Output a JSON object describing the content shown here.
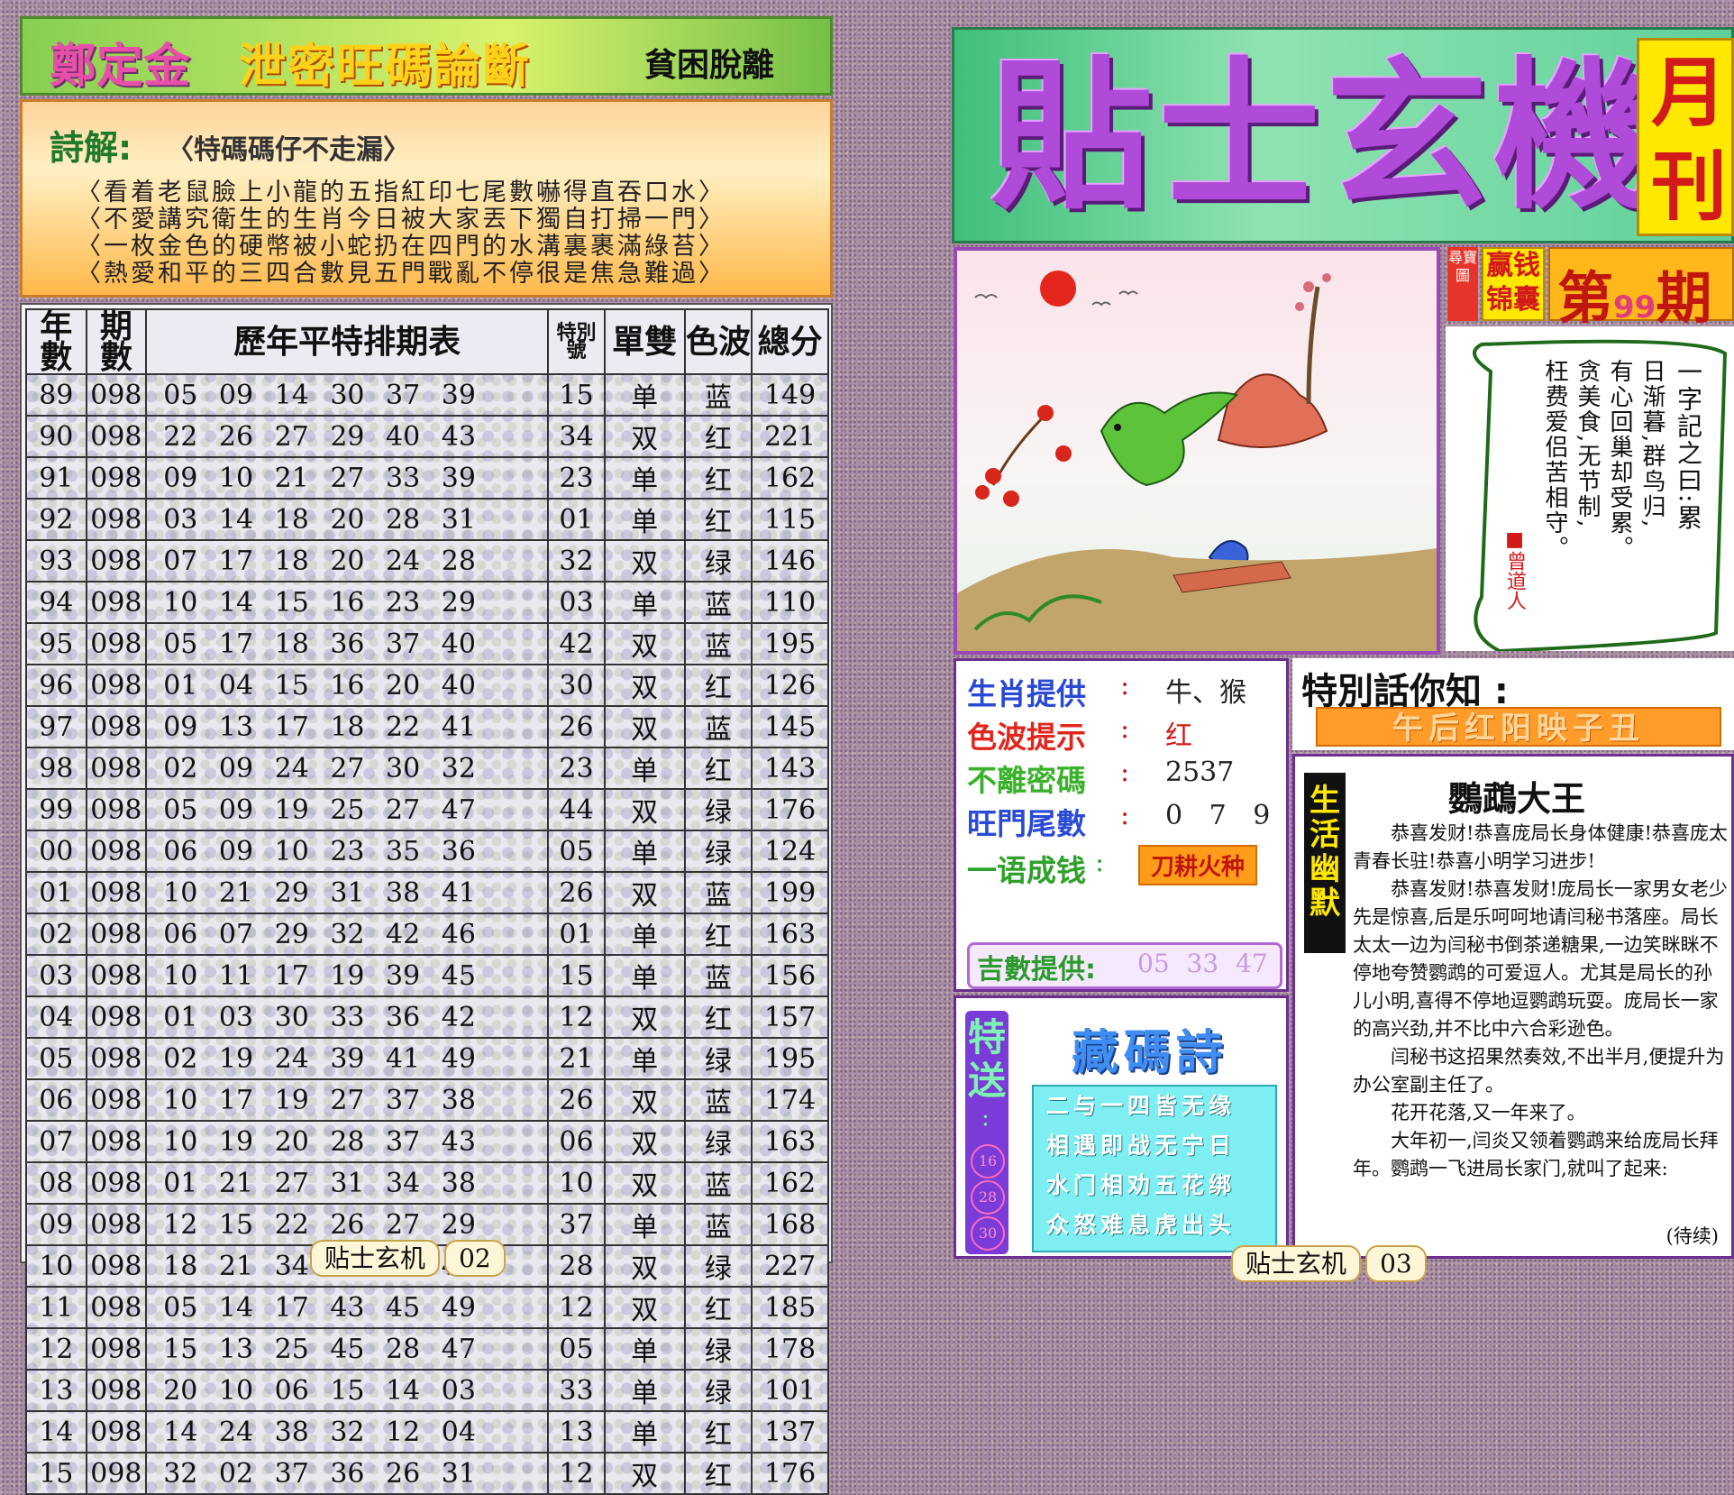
{
  "left": {
    "header": {
      "name": "鄭定金",
      "title": "泄密旺碼論斷",
      "subtitle": "貧困脫離"
    },
    "poem": {
      "label": "詩解:",
      "title": "〈特碼碼仔不走漏〉",
      "lines": [
        "〈看着老鼠臉上小龍的五指紅印七尾數嚇得直吞口水〉",
        "〈不愛講究衛生的生肖今日被大家丟下獨自打掃一門〉",
        "〈一枚金色的硬幣被小蛇扔在四門的水溝裏裹滿綠苔〉",
        "〈熱愛和平的三四合數見五門戰亂不停很是焦急難過〉"
      ]
    },
    "table": {
      "headers": [
        "年數",
        "期數",
        "歷年平特排期表",
        "特別號",
        "單雙",
        "色波",
        "總分"
      ],
      "rows": [
        [
          "89",
          "098",
          "05 09 14 30 37 39",
          "15",
          "单",
          "蓝",
          "149"
        ],
        [
          "90",
          "098",
          "22 26 27 29 40 43",
          "34",
          "双",
          "红",
          "221"
        ],
        [
          "91",
          "098",
          "09 10 21 27 33 39",
          "23",
          "单",
          "红",
          "162"
        ],
        [
          "92",
          "098",
          "03 14 18 20 28 31",
          "01",
          "单",
          "红",
          "115"
        ],
        [
          "93",
          "098",
          "07 17 18 20 24 28",
          "32",
          "双",
          "绿",
          "146"
        ],
        [
          "94",
          "098",
          "10 14 15 16 23 29",
          "03",
          "单",
          "蓝",
          "110"
        ],
        [
          "95",
          "098",
          "05 17 18 36 37 40",
          "42",
          "双",
          "蓝",
          "195"
        ],
        [
          "96",
          "098",
          "01 04 15 16 20 40",
          "30",
          "双",
          "红",
          "126"
        ],
        [
          "97",
          "098",
          "09 13 17 18 22 41",
          "26",
          "双",
          "蓝",
          "145"
        ],
        [
          "98",
          "098",
          "02 09 24 27 30 32",
          "23",
          "单",
          "红",
          "143"
        ],
        [
          "99",
          "098",
          "05 09 19 25 27 47",
          "44",
          "双",
          "绿",
          "176"
        ],
        [
          "00",
          "098",
          "06 09 10 23 35 36",
          "05",
          "单",
          "绿",
          "124"
        ],
        [
          "01",
          "098",
          "10 21 29 31 38 41",
          "26",
          "双",
          "蓝",
          "199"
        ],
        [
          "02",
          "098",
          "06 07 29 32 42 46",
          "01",
          "单",
          "红",
          "163"
        ],
        [
          "03",
          "098",
          "10 11 17 19 39 45",
          "15",
          "单",
          "蓝",
          "156"
        ],
        [
          "04",
          "098",
          "01 03 30 33 36 42",
          "12",
          "双",
          "红",
          "157"
        ],
        [
          "05",
          "098",
          "02 19 24 39 41 49",
          "21",
          "单",
          "绿",
          "195"
        ],
        [
          "06",
          "098",
          "10 17 19 27 37 38",
          "26",
          "双",
          "蓝",
          "174"
        ],
        [
          "07",
          "098",
          "10 19 20 28 37 43",
          "06",
          "双",
          "绿",
          "163"
        ],
        [
          "08",
          "098",
          "01 21 27 31 34 38",
          "10",
          "双",
          "蓝",
          "162"
        ],
        [
          "09",
          "098",
          "12 15 22 26 27 29",
          "37",
          "单",
          "蓝",
          "168"
        ],
        [
          "10",
          "098",
          "18 21 34 37 40 49",
          "28",
          "双",
          "绿",
          "227"
        ],
        [
          "11",
          "098",
          "05 14 17 43 45 49",
          "12",
          "双",
          "红",
          "185"
        ],
        [
          "12",
          "098",
          "15 13 25 45 28 47",
          "05",
          "单",
          "绿",
          "178"
        ],
        [
          "13",
          "098",
          "20 10 06 15 14 03",
          "33",
          "单",
          "绿",
          "101"
        ],
        [
          "14",
          "098",
          "14 24 38 32 12 04",
          "13",
          "单",
          "红",
          "137"
        ],
        [
          "15",
          "098",
          "32 02 37 36 26 31",
          "12",
          "双",
          "红",
          "176"
        ]
      ]
    },
    "footer": {
      "name": "贴士玄机",
      "page": "02"
    }
  },
  "right": {
    "title": "貼士玄機",
    "monthly": "月刊",
    "issue": {
      "side": "尋寶圖",
      "tags": "赢钱 锦囊",
      "prefix": "第",
      "number": "99",
      "suffix": "期"
    },
    "scroll": {
      "title": "一字記之曰:累",
      "cols": [
        "日渐暮,群鸟归,",
        "有心回巢却受累。",
        "贪美食,无节制,",
        "枉费爱侣苦相守。"
      ],
      "sign": "■曾道人"
    },
    "info": {
      "zodiac_label": "生肖提供",
      "zodiac_value": "牛、猴",
      "color_label": "色波提示",
      "color_value": "红",
      "code_label": "不離密碼",
      "code_value": "2537",
      "tail_label": "旺門尾數",
      "tail_value": "0 7 9",
      "phrase_label": "一语成钱",
      "phrase_value": "刀耕火种",
      "lucky_label": "吉數提供:",
      "lucky_value": "05 33 47",
      "colon": ":"
    },
    "talk": {
      "title": "特別話你知 :",
      "banner": "午后红阳映子丑"
    },
    "story": {
      "tag": "生活幽默",
      "title": "鸚鵡大王",
      "paragraphs": [
        "恭喜发财!恭喜庞局长身体健康!恭喜庞太青春长驻!恭喜小明学习进步!",
        "恭喜发财!恭喜发财!庞局长一家男女老少先是惊喜,后是乐呵呵地请闫秘书落座。局长太太一边为闫秘书倒茶递糖果,一边笑眯眯不停地夸赞鹦鹉的可爱逗人。尤其是局长的孙儿小明,喜得不停地逗鹦鹉玩耍。庞局长一家的高兴劲,并不比中六合彩逊色。",
        "闫秘书这招果然奏效,不出半月,便提升为办公室副主任了。",
        "花开花落,又一年来了。",
        "大年初一,闫炎又领着鹦鹉来给庞局长拜年。鹦鹉一飞进局长家门,就叫了起来:"
      ],
      "end": "(待续)"
    },
    "gift": {
      "label": "特送",
      "colon": ":",
      "numbers": [
        "16",
        "28",
        "30"
      ],
      "poem_title": "藏碼詩",
      "poem_lines": [
        "二与一四皆无缘",
        "相遇即战无宁日",
        "水门相劝五花绑",
        "众怒难息虎出头"
      ]
    },
    "footer": {
      "name": "贴士玄机",
      "page": "03"
    }
  }
}
